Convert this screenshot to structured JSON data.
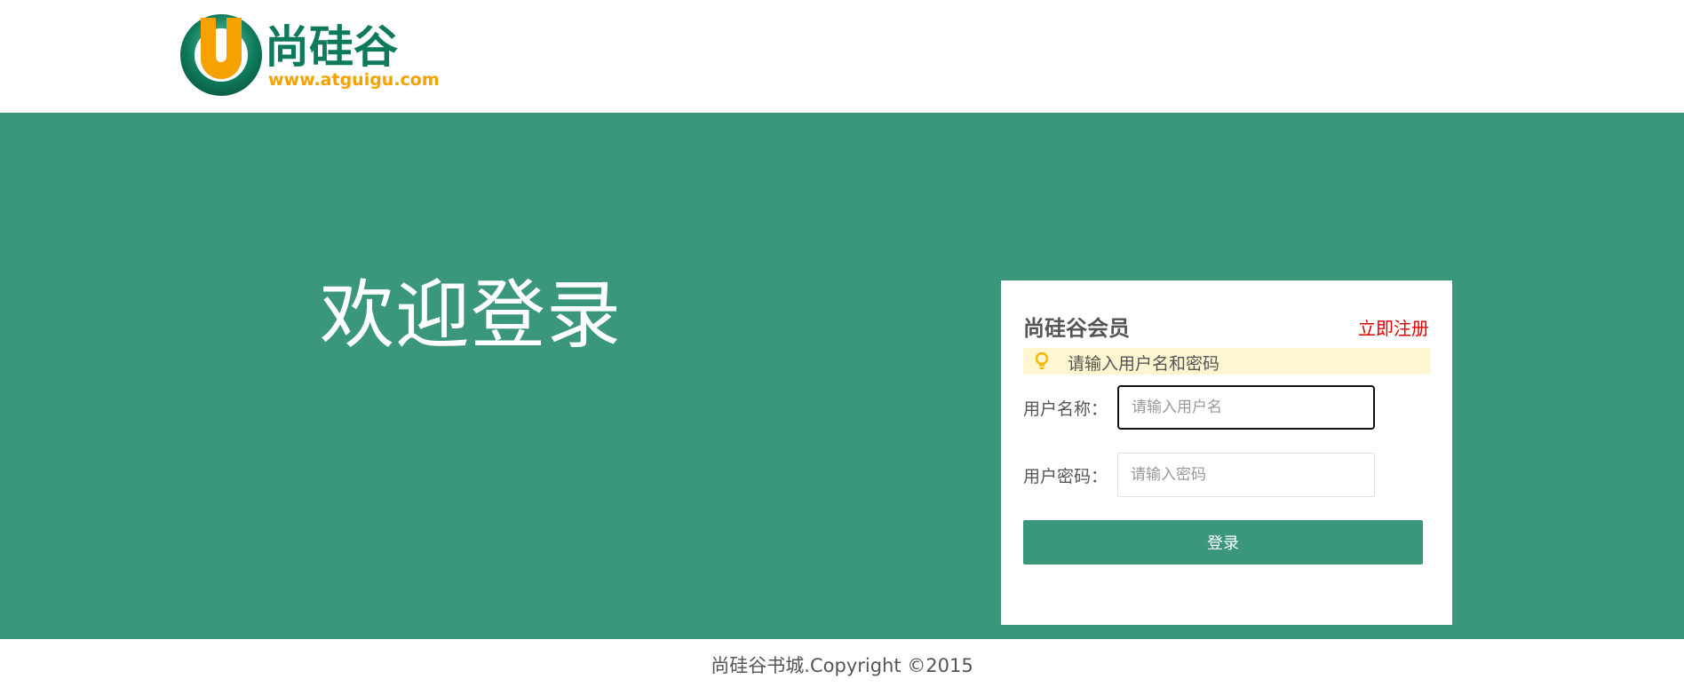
{
  "logo": {
    "brand_mark": "U",
    "brand_name": "尚硅谷",
    "domain": "www.atguigu.com"
  },
  "main": {
    "welcome_text": "欢迎登录"
  },
  "login_card": {
    "title": "尚硅谷会员",
    "register_link": "立即注册",
    "tip": {
      "icon": "lightbulb-icon",
      "text": "请输入用户名和密码"
    },
    "username": {
      "label": "用户名称：",
      "placeholder": "请输入用户名",
      "value": ""
    },
    "password": {
      "label": "用户密码：",
      "placeholder": "请输入密码",
      "value": ""
    },
    "submit_label": "登录"
  },
  "footer": {
    "copyright": "尚硅谷书城.Copyright ©2015"
  },
  "colors": {
    "brand_green": "#3a977c",
    "logo_orange": "#f5a200",
    "logo_green": "#0e7a5c",
    "register_red": "#e00000",
    "tip_background": "#fff5d1"
  }
}
